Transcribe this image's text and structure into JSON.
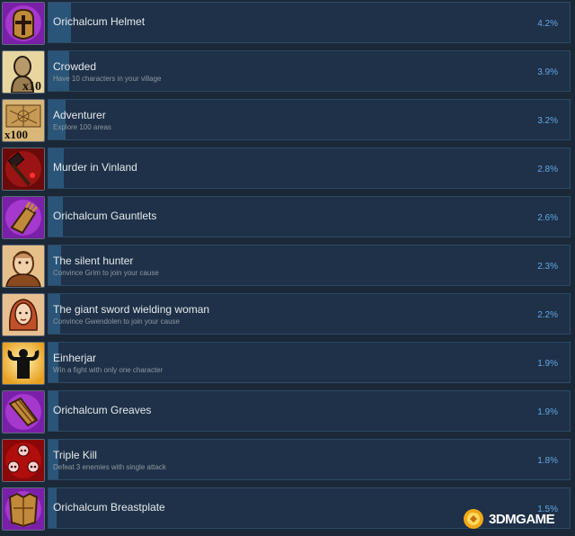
{
  "achievements": [
    {
      "title": "Orichalcum Helmet",
      "description": "",
      "percent": "4.2%",
      "fill": 0.042,
      "icon": "orichalcum-helmet-icon"
    },
    {
      "title": "Crowded",
      "description": "Have 10 characters in your village",
      "percent": "3.9%",
      "fill": 0.039,
      "icon": "crowded-villager-icon",
      "badge": "x10"
    },
    {
      "title": "Adventurer",
      "description": "Explore 100 areas",
      "percent": "3.2%",
      "fill": 0.032,
      "icon": "map-icon",
      "badge": "x100"
    },
    {
      "title": "Murder in Vinland",
      "description": "",
      "percent": "2.8%",
      "fill": 0.028,
      "icon": "bloody-hammer-icon"
    },
    {
      "title": "Orichalcum Gauntlets",
      "description": "",
      "percent": "2.6%",
      "fill": 0.026,
      "icon": "orichalcum-gauntlets-icon"
    },
    {
      "title": "The silent hunter",
      "description": "Convince Grim to join your cause",
      "percent": "2.3%",
      "fill": 0.023,
      "icon": "grim-portrait-icon"
    },
    {
      "title": "The giant sword wielding woman",
      "description": "Convince Gwendolen to join your cause",
      "percent": "2.2%",
      "fill": 0.022,
      "icon": "gwendolen-portrait-icon"
    },
    {
      "title": "Einherjar",
      "description": "Win a fight with only one character",
      "percent": "1.9%",
      "fill": 0.019,
      "icon": "strongman-silhouette-icon"
    },
    {
      "title": "Orichalcum Greaves",
      "description": "",
      "percent": "1.9%",
      "fill": 0.019,
      "icon": "orichalcum-greaves-icon"
    },
    {
      "title": "Triple Kill",
      "description": "Defeat 3 enemies with single attack",
      "percent": "1.8%",
      "fill": 0.018,
      "icon": "three-skulls-icon"
    },
    {
      "title": "Orichalcum Breastplate",
      "description": "",
      "percent": "1.5%",
      "fill": 0.015,
      "icon": "orichalcum-breastplate-icon"
    }
  ],
  "watermark": {
    "text": "3DMGAME"
  },
  "colors": {
    "background": "#1b2838",
    "panel": "#1e3148",
    "bar": "#2a5578",
    "percent": "#62a7e3"
  }
}
